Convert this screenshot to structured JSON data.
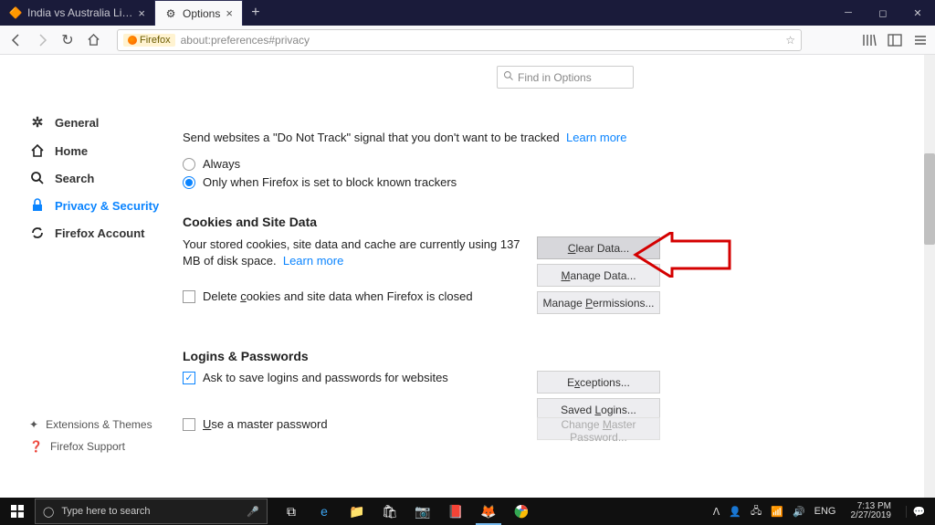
{
  "titlebar": {
    "tabs": [
      {
        "label": "India vs Australia Live Streamin",
        "active": false
      },
      {
        "label": "Options",
        "active": true
      }
    ]
  },
  "toolbar": {
    "urlbar_prefix": "Firefox",
    "url": "about:preferences#privacy"
  },
  "search_box": {
    "placeholder": "Find in Options"
  },
  "sidebar": [
    {
      "icon": "gear",
      "label": "General"
    },
    {
      "icon": "home",
      "label": "Home"
    },
    {
      "icon": "search",
      "label": "Search"
    },
    {
      "icon": "lock",
      "label": "Privacy & Security",
      "active": true
    },
    {
      "icon": "sync",
      "label": "Firefox Account"
    }
  ],
  "sidebar_footer": [
    {
      "icon": "puzzle",
      "label": "Extensions & Themes"
    },
    {
      "icon": "help",
      "label": "Firefox Support"
    }
  ],
  "dnt": {
    "line": "Send websites a \"Do Not Track\" signal that you don't want to be tracked",
    "learn": "Learn more",
    "opt_always": "Always",
    "opt_only": "Only when Firefox is set to block known trackers"
  },
  "cookies": {
    "heading": "Cookies and Site Data",
    "desc": "Your stored cookies, site data and cache are currently using 137 MB of disk space.",
    "learn": "Learn more",
    "delete_label": "Delete cookies and site data when Firefox is closed",
    "btn_clear": "Clear Data...",
    "btn_manage": "Manage Data...",
    "btn_perm": "Manage Permissions..."
  },
  "logins": {
    "heading": "Logins & Passwords",
    "ask_label": "Ask to save logins and passwords for websites",
    "master_label": "Use a master password",
    "btn_exceptions": "Exceptions...",
    "btn_saved": "Saved Logins...",
    "btn_change": "Change Master Password..."
  },
  "taskbar": {
    "search_placeholder": "Type here to search",
    "lang": "ENG",
    "time": "7:13 PM",
    "date": "2/27/2019"
  }
}
